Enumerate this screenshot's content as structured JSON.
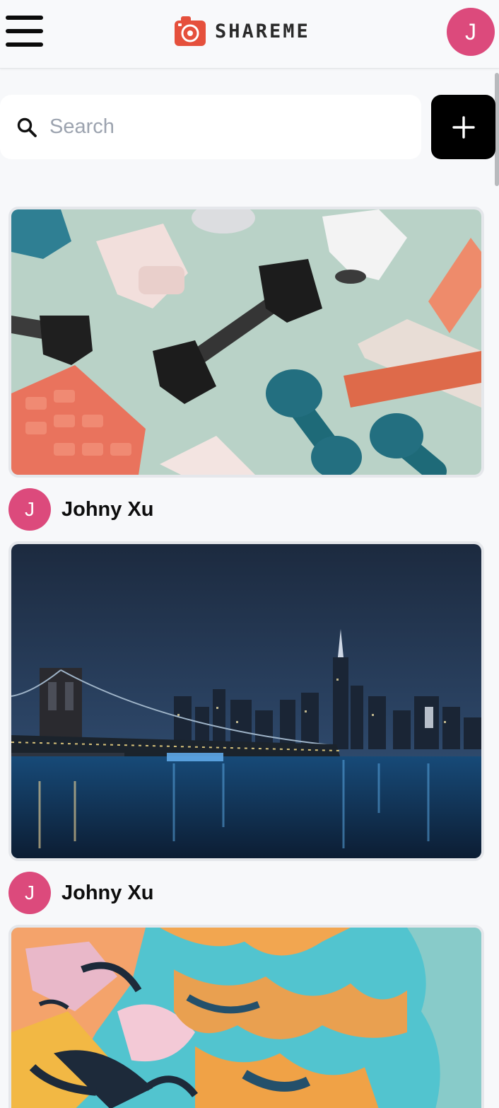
{
  "header": {
    "menu_icon": "hamburger-menu-icon",
    "logo_icon": "camera-icon",
    "logo_text": "SHAREME",
    "logo_color": "#e5503c",
    "user_initial": "J",
    "avatar_color": "#dc4a7c"
  },
  "search": {
    "placeholder": "Search",
    "value": "",
    "icon": "search-icon"
  },
  "add_button": {
    "icon": "plus-icon"
  },
  "pins": [
    {
      "image_subject": "fitness-equipment-dumbbells-photo",
      "user_initial": "J",
      "user_name": "Johny Xu"
    },
    {
      "image_subject": "city-skyline-bridge-night-photo",
      "user_initial": "J",
      "user_name": "Johny Xu"
    },
    {
      "image_subject": "colorful-graffiti-mural-photo"
    }
  ]
}
